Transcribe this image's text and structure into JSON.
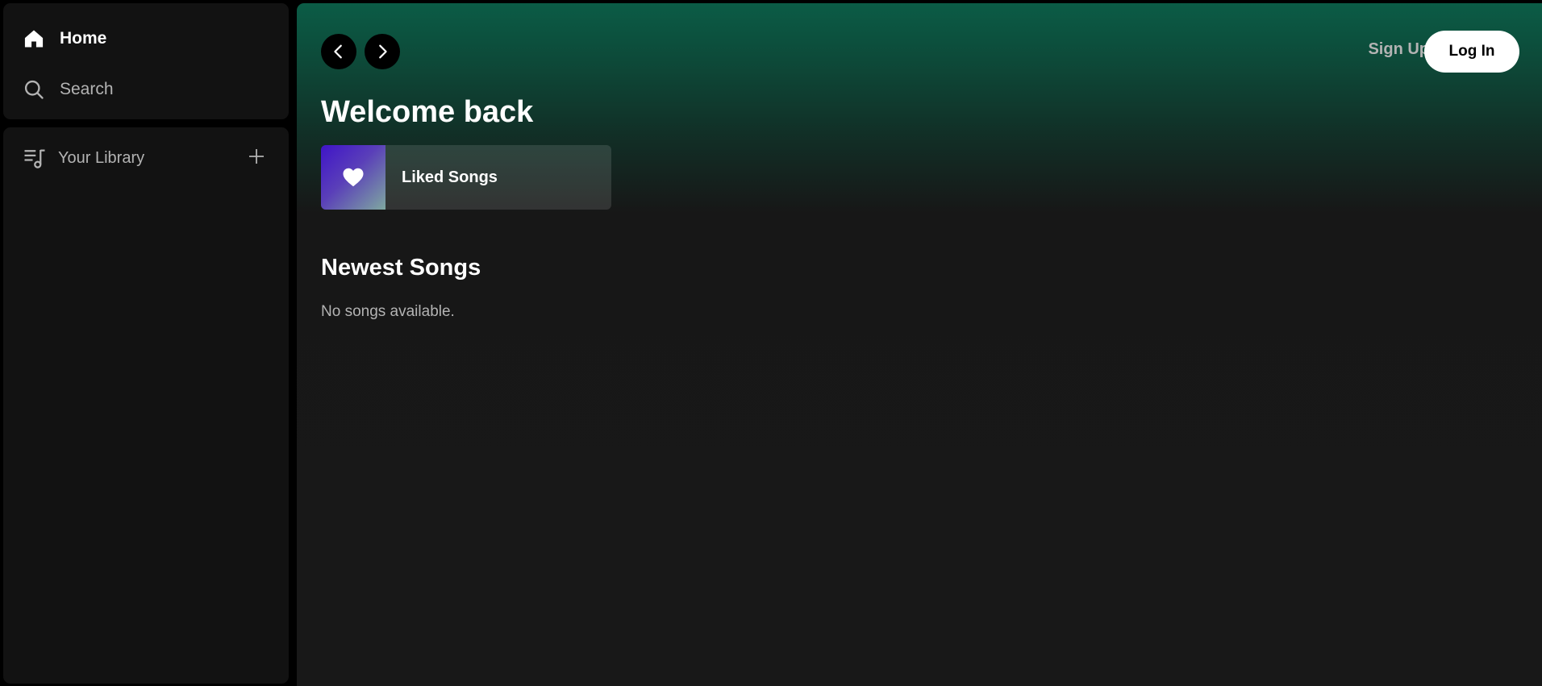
{
  "sidebar": {
    "nav": {
      "home_label": "Home",
      "search_label": "Search"
    },
    "library": {
      "label": "Your Library",
      "add_icon": "plus-icon"
    }
  },
  "header": {
    "back_icon": "chevron-left-icon",
    "forward_icon": "chevron-right-icon",
    "signup_label": "Sign Up",
    "login_label": "Log In"
  },
  "main": {
    "greeting": "Welcome back",
    "quick_access": [
      {
        "label": "Liked Songs",
        "icon": "heart-icon"
      }
    ],
    "newest_songs": {
      "title": "Newest Songs",
      "empty_message": "No songs available."
    }
  },
  "colors": {
    "accent_green": "#0b5c46",
    "background": "#121212",
    "muted_text": "#b3b3b3",
    "liked_gradient_start": "#3f14c8",
    "liked_gradient_end": "#7fa8a0"
  }
}
